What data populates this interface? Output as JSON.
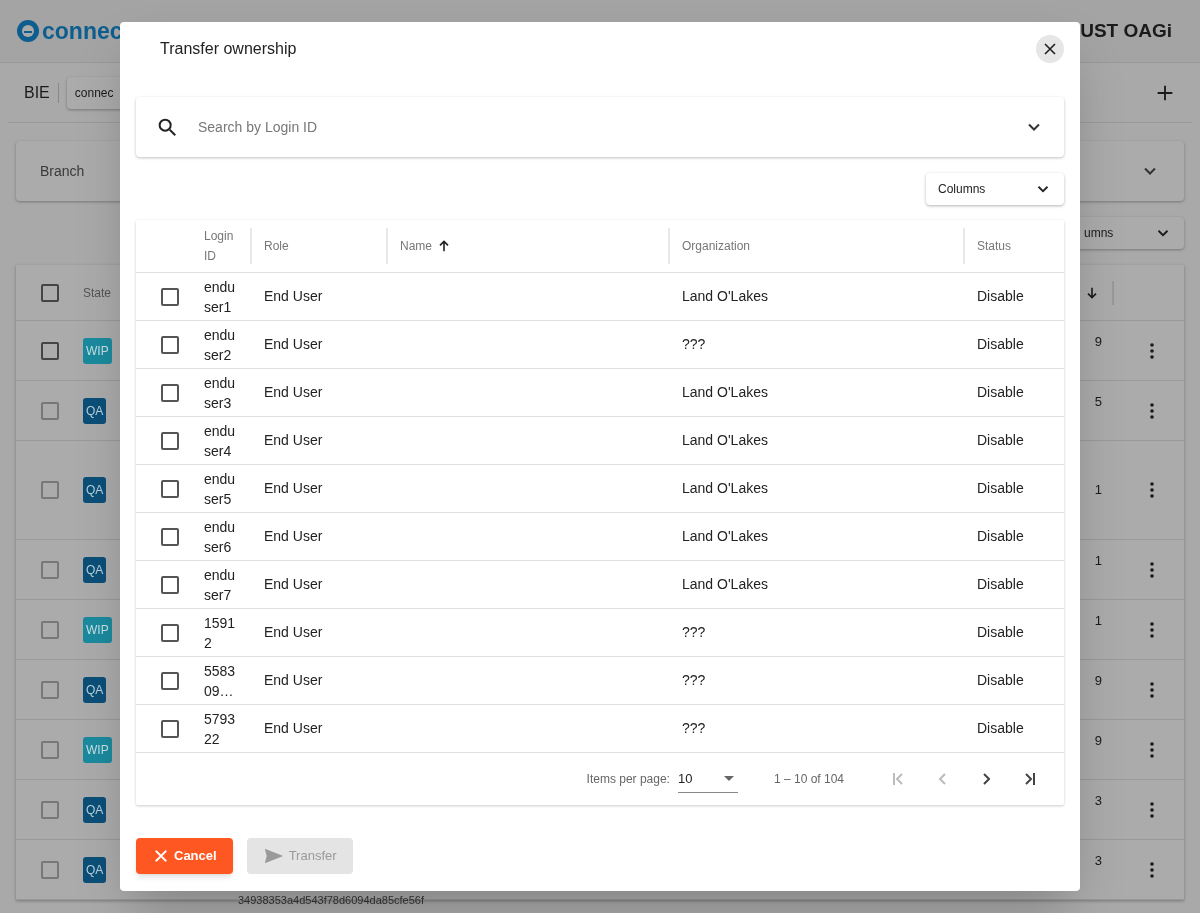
{
  "header": {
    "logo_text": "connec",
    "brand_text": "UST OAGi"
  },
  "toolbar": {
    "title": "BIE",
    "button_label": "connec"
  },
  "filter_panel": {
    "label": "Branch"
  },
  "columns_menu": {
    "label": "umns"
  },
  "background_table": {
    "header_label": "State",
    "select_all_checked": false,
    "rows": [
      {
        "state": "WIP",
        "kind": "wip",
        "tail": "9",
        "checked": false
      },
      {
        "state": "QA",
        "kind": "qa",
        "tail": "5",
        "checked": false
      },
      {
        "state": "QA",
        "kind": "qa",
        "tail": "1",
        "checked": false
      },
      {
        "state": "QA",
        "kind": "qa",
        "tail": "1",
        "checked": false
      },
      {
        "state": "WIP",
        "kind": "wip",
        "tail": "1",
        "checked": false
      },
      {
        "state": "QA",
        "kind": "qa",
        "tail": "9",
        "checked": false
      },
      {
        "state": "WIP",
        "kind": "wip",
        "tail": "9",
        "checked": false
      },
      {
        "state": "QA",
        "kind": "qa",
        "tail": "3",
        "checked": false
      },
      {
        "state": "QA",
        "kind": "qa",
        "tail": "3",
        "checked": false
      }
    ],
    "footer_text": "34938353a4d543f78d6094da85cfe56f"
  },
  "dialog": {
    "title": "Transfer ownership",
    "search": {
      "placeholder": "Search by Login ID"
    },
    "columns_button": "Columns",
    "table": {
      "columns": [
        {
          "label": "Login ID",
          "sorted": false
        },
        {
          "label": "Role",
          "sorted": false
        },
        {
          "label": "Name",
          "sorted": true
        },
        {
          "label": "Organization",
          "sorted": false
        },
        {
          "label": "Status",
          "sorted": false
        }
      ],
      "rows": [
        {
          "login_id": "enduser1",
          "role": "End User",
          "organization": "Land O'Lakes",
          "status": "Disable",
          "checked": false
        },
        {
          "login_id": "enduser2",
          "role": "End User",
          "organization": "???",
          "status": "Disable",
          "checked": false
        },
        {
          "login_id": "enduser3",
          "role": "End User",
          "organization": "Land O'Lakes",
          "status": "Disable",
          "checked": false
        },
        {
          "login_id": "enduser4",
          "role": "End User",
          "organization": "Land O'Lakes",
          "status": "Disable",
          "checked": false
        },
        {
          "login_id": "enduser5",
          "role": "End User",
          "organization": "Land O'Lakes",
          "status": "Disable",
          "checked": false
        },
        {
          "login_id": "enduser6",
          "role": "End User",
          "organization": "Land O'Lakes",
          "status": "Disable",
          "checked": false
        },
        {
          "login_id": "enduser7",
          "role": "End User",
          "organization": "Land O'Lakes",
          "status": "Disable",
          "checked": false
        },
        {
          "login_id": "15912",
          "role": "End User",
          "organization": "???",
          "status": "Disable",
          "checked": false
        },
        {
          "login_id": "558309…",
          "role": "End User",
          "organization": "???",
          "status": "Disable",
          "checked": false
        },
        {
          "login_id": "579322",
          "role": "End User",
          "organization": "???",
          "status": "Disable",
          "checked": false
        }
      ]
    },
    "paginator": {
      "items_label": "Items per page:",
      "page_size": "10",
      "range": "1 – 10 of 104",
      "first_disabled": true,
      "prev_disabled": true,
      "next_disabled": false,
      "last_disabled": false
    },
    "buttons": [
      {
        "label": "Cancel",
        "kind": "cancel",
        "disabled": false
      },
      {
        "label": "Transfer",
        "kind": "transfer",
        "disabled": true
      }
    ]
  }
}
